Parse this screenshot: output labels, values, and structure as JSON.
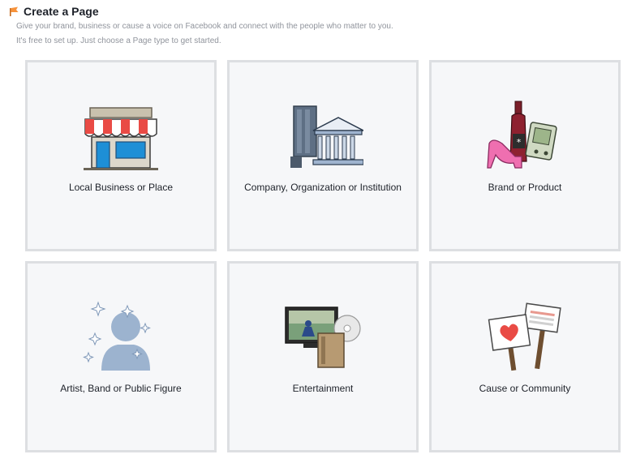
{
  "header": {
    "title": "Create a Page",
    "subtitle_line1": "Give your brand, business or cause a voice on Facebook and connect with the people who matter to you.",
    "subtitle_line2": "It's free to set up. Just choose a Page type to get started."
  },
  "categories": [
    {
      "label": "Local Business or Place",
      "icon": "storefront-icon"
    },
    {
      "label": "Company, Organization or Institution",
      "icon": "buildings-icon"
    },
    {
      "label": "Brand or Product",
      "icon": "products-icon"
    },
    {
      "label": "Artist, Band or Public Figure",
      "icon": "person-silhouette-icon"
    },
    {
      "label": "Entertainment",
      "icon": "media-icon"
    },
    {
      "label": "Cause or Community",
      "icon": "signs-icon"
    }
  ],
  "colors": {
    "tile_background": "#f6f7f9",
    "tile_border": "#dddfe2",
    "title_text": "#1d2129",
    "subtitle_text": "#90949c",
    "flag_accent": "#f7923a"
  }
}
